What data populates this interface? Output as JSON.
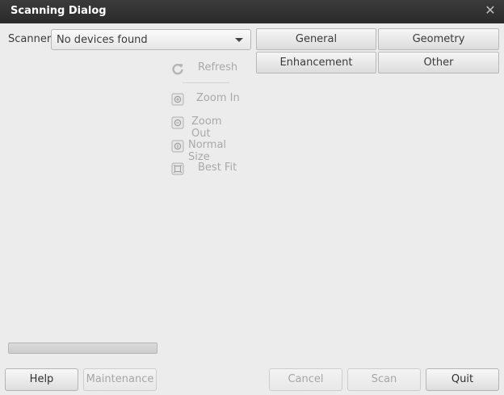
{
  "window": {
    "title": "Scanning Dialog",
    "close_icon": "close-icon"
  },
  "scanner": {
    "label": "Scanner:",
    "selected": "No devices found"
  },
  "tabs": [
    {
      "label": "General"
    },
    {
      "label": "Geometry"
    },
    {
      "label": "Enhancement"
    },
    {
      "label": "Other"
    }
  ],
  "preview_tools": [
    {
      "label": "Refresh",
      "icon": "refresh-icon",
      "enabled": false
    },
    {
      "label": "Zoom In",
      "icon": "zoom-in-icon",
      "enabled": false
    },
    {
      "label": "Zoom Out",
      "icon": "zoom-out-icon",
      "enabled": false
    },
    {
      "label": "Normal Size",
      "icon": "normal-size-icon",
      "enabled": false
    },
    {
      "label": "Best Fit",
      "icon": "best-fit-icon",
      "enabled": false
    }
  ],
  "progress": {
    "value": 0
  },
  "buttons": {
    "help": "Help",
    "maintenance": "Maintenance",
    "cancel": "Cancel",
    "scan": "Scan",
    "quit": "Quit"
  },
  "colors": {
    "titlebar": "#2f2f2f",
    "window_bg": "#ececec",
    "disabled_text": "#a9a9a9"
  }
}
